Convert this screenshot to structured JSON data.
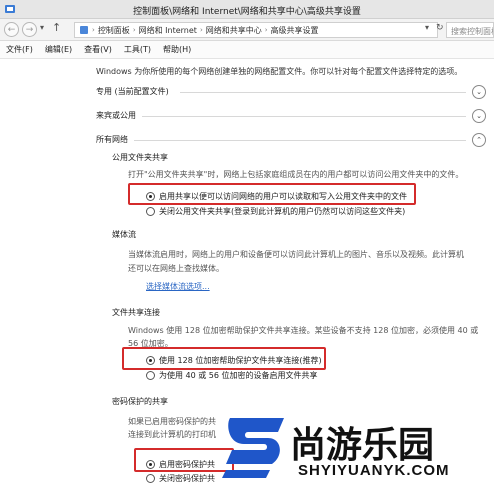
{
  "window": {
    "title": "控制面板\\网络和 Internet\\网络和共享中心\\高级共享设置"
  },
  "address": {
    "crumbs": [
      "控制面板",
      "网络和 Internet",
      "网络和共享中心",
      "高级共享设置"
    ],
    "search_placeholder": "搜索控制面板"
  },
  "menu": {
    "items": [
      "文件(F)",
      "编辑(E)",
      "查看(V)",
      "工具(T)",
      "帮助(H)"
    ]
  },
  "content": {
    "intro": "Windows 为你所使用的每个网络创建单独的网络配置文件。你可以针对每个配置文件选择特定的选项。",
    "profiles": {
      "private": "专用 (当前配置文件)",
      "guest": "来宾或公用",
      "all": "所有网络"
    },
    "public_folder": {
      "title": "公用文件夹共享",
      "desc": "打开\"公用文件夹共享\"时，网络上包括家庭组成员在内的用户都可以访问公用文件夹中的文件。",
      "option_on": "启用共享以便可以访问网络的用户可以读取和写入公用文件夹中的文件",
      "option_off": "关闭公用文件夹共享(登录到此计算机的用户仍然可以访问这些文件夹)"
    },
    "media": {
      "title": "媒体流",
      "desc_line1": "当媒体流启用时，网络上的用户和设备便可以访问此计算机上的图片、音乐以及视频。此计算机",
      "desc_line2": "还可以在网络上查找媒体。",
      "link": "选择媒体流选项..."
    },
    "file_sharing": {
      "title": "文件共享连接",
      "desc_line1": "Windows 使用 128 位加密帮助保护文件共享连接。某些设备不支持 128 位加密，必须使用 40 或",
      "desc_line2": "56 位加密。",
      "option_128": "使用 128 位加密帮助保护文件共享连接(推荐)",
      "option_40": "为使用 40 或 56 位加密的设备启用文件共享"
    },
    "password": {
      "title": "密码保护的共享",
      "desc_line1": "如果已启用密码保护的共",
      "desc_line2": "连接到此计算机的打印机",
      "option_on": "启用密码保护共",
      "option_off": "关闭密码保护共"
    }
  },
  "watermark": {
    "name": "尚游乐园",
    "url": "SHYIYUANYK.COM"
  },
  "colors": {
    "highlight_box": "#d42b2b",
    "link": "#2a66c4",
    "logo_blue": "#1f56c9"
  }
}
